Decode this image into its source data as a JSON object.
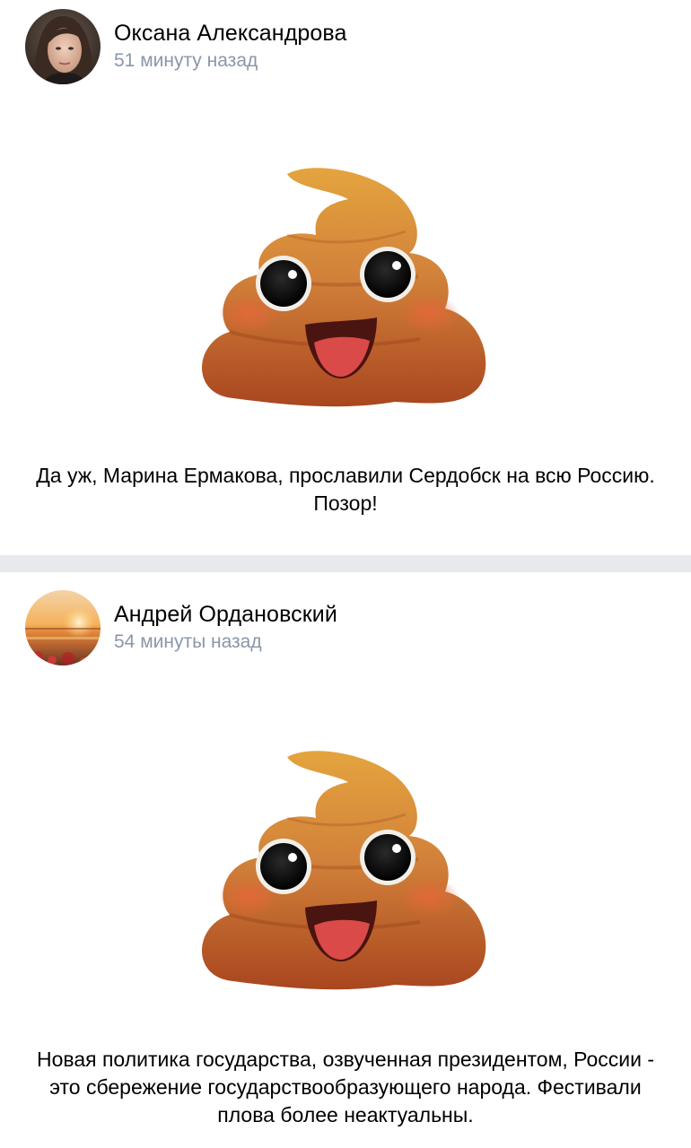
{
  "posts": [
    {
      "author": "Оксана Александрова",
      "time": "51 минуту назад",
      "text": "Да уж, Марина Ермакова, прославили Сердобск на всю Россию. Позор!",
      "avatar_icon": "woman-portrait-avatar",
      "image_icon": "pile-of-poo-emoji"
    },
    {
      "author": "Андрей Ордановский",
      "time": "54 минуты назад",
      "text": "Новая политика государства, озвученная президентом, России - это сбережение государствообразующего народа. Фестивали плова более неактуальны.",
      "avatar_icon": "sunset-sea-avatar",
      "image_icon": "pile-of-poo-emoji"
    }
  ],
  "colors": {
    "separator": "#e8e9ed",
    "time_text": "#8a96a8",
    "poo_top": "#e0a23c",
    "poo_bottom": "#b64e22"
  }
}
